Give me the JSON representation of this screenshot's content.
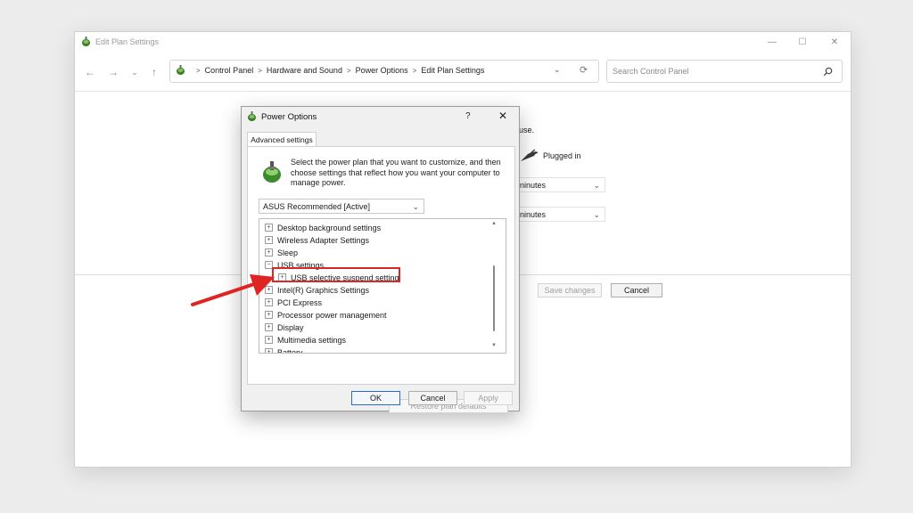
{
  "main_window": {
    "title": "Edit Plan Settings",
    "controls": {
      "minimize": "—",
      "maximize": "☐",
      "close": "✕"
    },
    "nav": {
      "back": "←",
      "forward": "→",
      "recent": "⌄",
      "up": "↑"
    },
    "breadcrumb": [
      "Control Panel",
      "Hardware and Sound",
      "Power Options",
      "Edit Plan Settings"
    ],
    "address_dropdown": "⌄",
    "refresh": "⟳",
    "search": {
      "placeholder": "Search Control Panel",
      "value": ""
    },
    "partial_text": {
      "use": "use.",
      "plugged_in": "Plugged in",
      "combo1": "ninutes",
      "combo2": "ninutes"
    },
    "buttons": {
      "save_changes": "Save changes",
      "cancel": "Cancel"
    }
  },
  "dialog": {
    "title": "Power Options",
    "help": "?",
    "close": "✕",
    "tab": "Advanced settings",
    "description": "Select the power plan that you want to customize, and then choose settings that reflect how you want your computer to manage power.",
    "plan_select": "ASUS Recommended [Active]",
    "tree": [
      {
        "label": "Desktop background settings",
        "expander": "+",
        "level": 0
      },
      {
        "label": "Wireless Adapter Settings",
        "expander": "+",
        "level": 0
      },
      {
        "label": "Sleep",
        "expander": "+",
        "level": 0
      },
      {
        "label": "USB settings",
        "expander": "−",
        "level": 0
      },
      {
        "label": "USB selective suspend setting",
        "expander": "+",
        "level": 1,
        "highlighted": true
      },
      {
        "label": "Intel(R) Graphics Settings",
        "expander": "+",
        "level": 0
      },
      {
        "label": "PCI Express",
        "expander": "+",
        "level": 0
      },
      {
        "label": "Processor power management",
        "expander": "+",
        "level": 0
      },
      {
        "label": "Display",
        "expander": "+",
        "level": 0
      },
      {
        "label": "Multimedia settings",
        "expander": "+",
        "level": 0
      },
      {
        "label": "Battery",
        "expander": "+",
        "level": 0
      }
    ],
    "buttons": {
      "restore": "Restore plan defaults",
      "ok": "OK",
      "cancel": "Cancel",
      "apply": "Apply"
    }
  },
  "colors": {
    "highlight_border": "#d42a2a",
    "arrow": "#e02424",
    "ok_border": "#2b6cc4"
  },
  "icons": [
    "power-options-icon",
    "battery-plug-icon",
    "red-pointer-arrow"
  ]
}
